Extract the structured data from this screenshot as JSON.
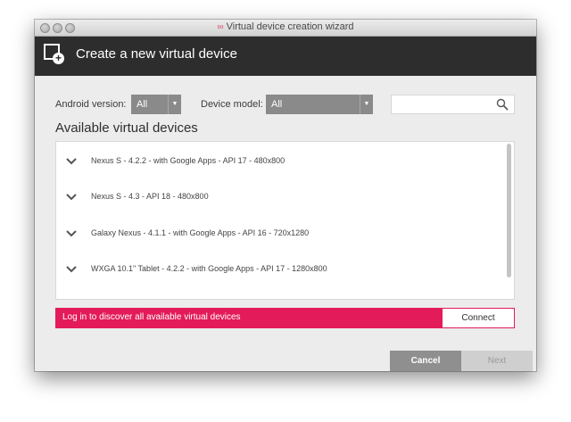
{
  "window": {
    "title": "Virtual device creation wizard"
  },
  "header": {
    "title": "Create a new virtual device"
  },
  "filters": {
    "android_version_label": "Android version:",
    "android_version_value": "All",
    "device_model_label": "Device model:",
    "device_model_value": "All",
    "search_placeholder": ""
  },
  "section_title": "Available virtual devices",
  "devices": [
    {
      "label": "Nexus S - 4.2.2 - with Google Apps - API 17 - 480x800"
    },
    {
      "label": "Nexus S - 4.3 - API 18 - 480x800"
    },
    {
      "label": "Galaxy Nexus - 4.1.1 - with Google Apps - API 16 - 720x1280"
    },
    {
      "label": "WXGA 10.1\" Tablet - 4.2.2 - with Google Apps - API 17 - 1280x800"
    }
  ],
  "banner": {
    "text": "Log in to discover all available virtual devices",
    "button": "Connect",
    "color": "#e31b5a"
  },
  "footer": {
    "cancel": "Cancel",
    "next": "Next"
  },
  "colors": {
    "header_bg": "#2d2d2d",
    "select_bg": "#8a8a8a"
  }
}
